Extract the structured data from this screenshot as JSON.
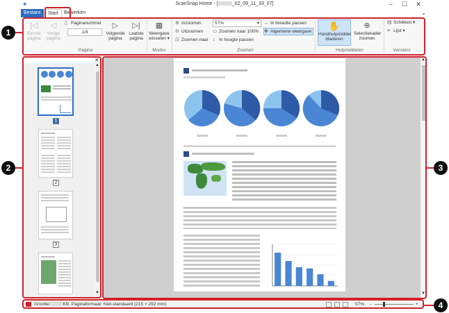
{
  "window": {
    "title": "ScanSnap Home - [",
    "title_suffix": "_02_09_11_33_07]",
    "min": "–",
    "max": "☐",
    "close": "✕"
  },
  "tabs": [
    {
      "label": "Bestanc"
    },
    {
      "label": "Start"
    },
    {
      "label": "Bewerken"
    }
  ],
  "ribbon": {
    "first_page": "Eerste pagina",
    "first_page_l1": "Eerste",
    "first_page_l2": "pagina",
    "prev_page_l1": "Vorige",
    "prev_page_l2": "pagina",
    "page_number_label": "Paginanummer",
    "page_number_value": "1/4",
    "next_page_l1": "Volgende",
    "next_page_l2": "pagina",
    "last_page_l1": "Laatste",
    "last_page_l2": "pagina",
    "group_page": "Pagina",
    "view_switch_l1": "Weergave",
    "view_switch_l2": "wisselen ▾",
    "group_mode": "Modus",
    "zoom_in": "Inzoomen",
    "zoom_out": "Uitzoomen",
    "zoom_to": "Zoomen naar",
    "zoom_value": "57%",
    "zoom_100": "Zoomen naar 100%",
    "fit_height": "In hoogte passen",
    "fit_width": "In breedte passen",
    "general_view": "Algemene weergave",
    "group_zoom": "Zoomen",
    "hand_tool_l1": "Handhulpmiddel",
    "hand_tool_l2": "bladeren",
    "select_zoom_l1": "Selectiekader",
    "select_zoom_l2": "zoomen",
    "group_tools": "Hulpmiddelen",
    "arrange": "Schikken ▾",
    "list": "Lijst ▾",
    "group_windows": "Vensters"
  },
  "thumbnails": [
    {
      "num": "1"
    },
    {
      "num": "2"
    },
    {
      "num": "3"
    }
  ],
  "status": {
    "size_prefix": "Grootte:",
    "size_suffix": "KB, Paginaformaat: Niet-standaard (215 × 292 mm)",
    "zoom": "57%"
  },
  "callouts": [
    "1",
    "2",
    "3",
    "4"
  ],
  "colors": {
    "accent": "#2b6cc4",
    "callout_border": "#d0202a",
    "pie_dark": "#2f5aa8",
    "pie_mid": "#4a86d4",
    "pie_light": "#8cc4ee",
    "map_green": "#3d8a3d"
  },
  "chart_data": {
    "type": "bar",
    "categories": [
      "",
      "",
      "",
      "",
      "",
      ""
    ],
    "values": [
      8,
      6,
      4.5,
      4.2,
      2.8,
      1.2
    ],
    "title": "",
    "xlabel": "",
    "ylabel": "",
    "ylim": [
      0,
      10
    ]
  }
}
